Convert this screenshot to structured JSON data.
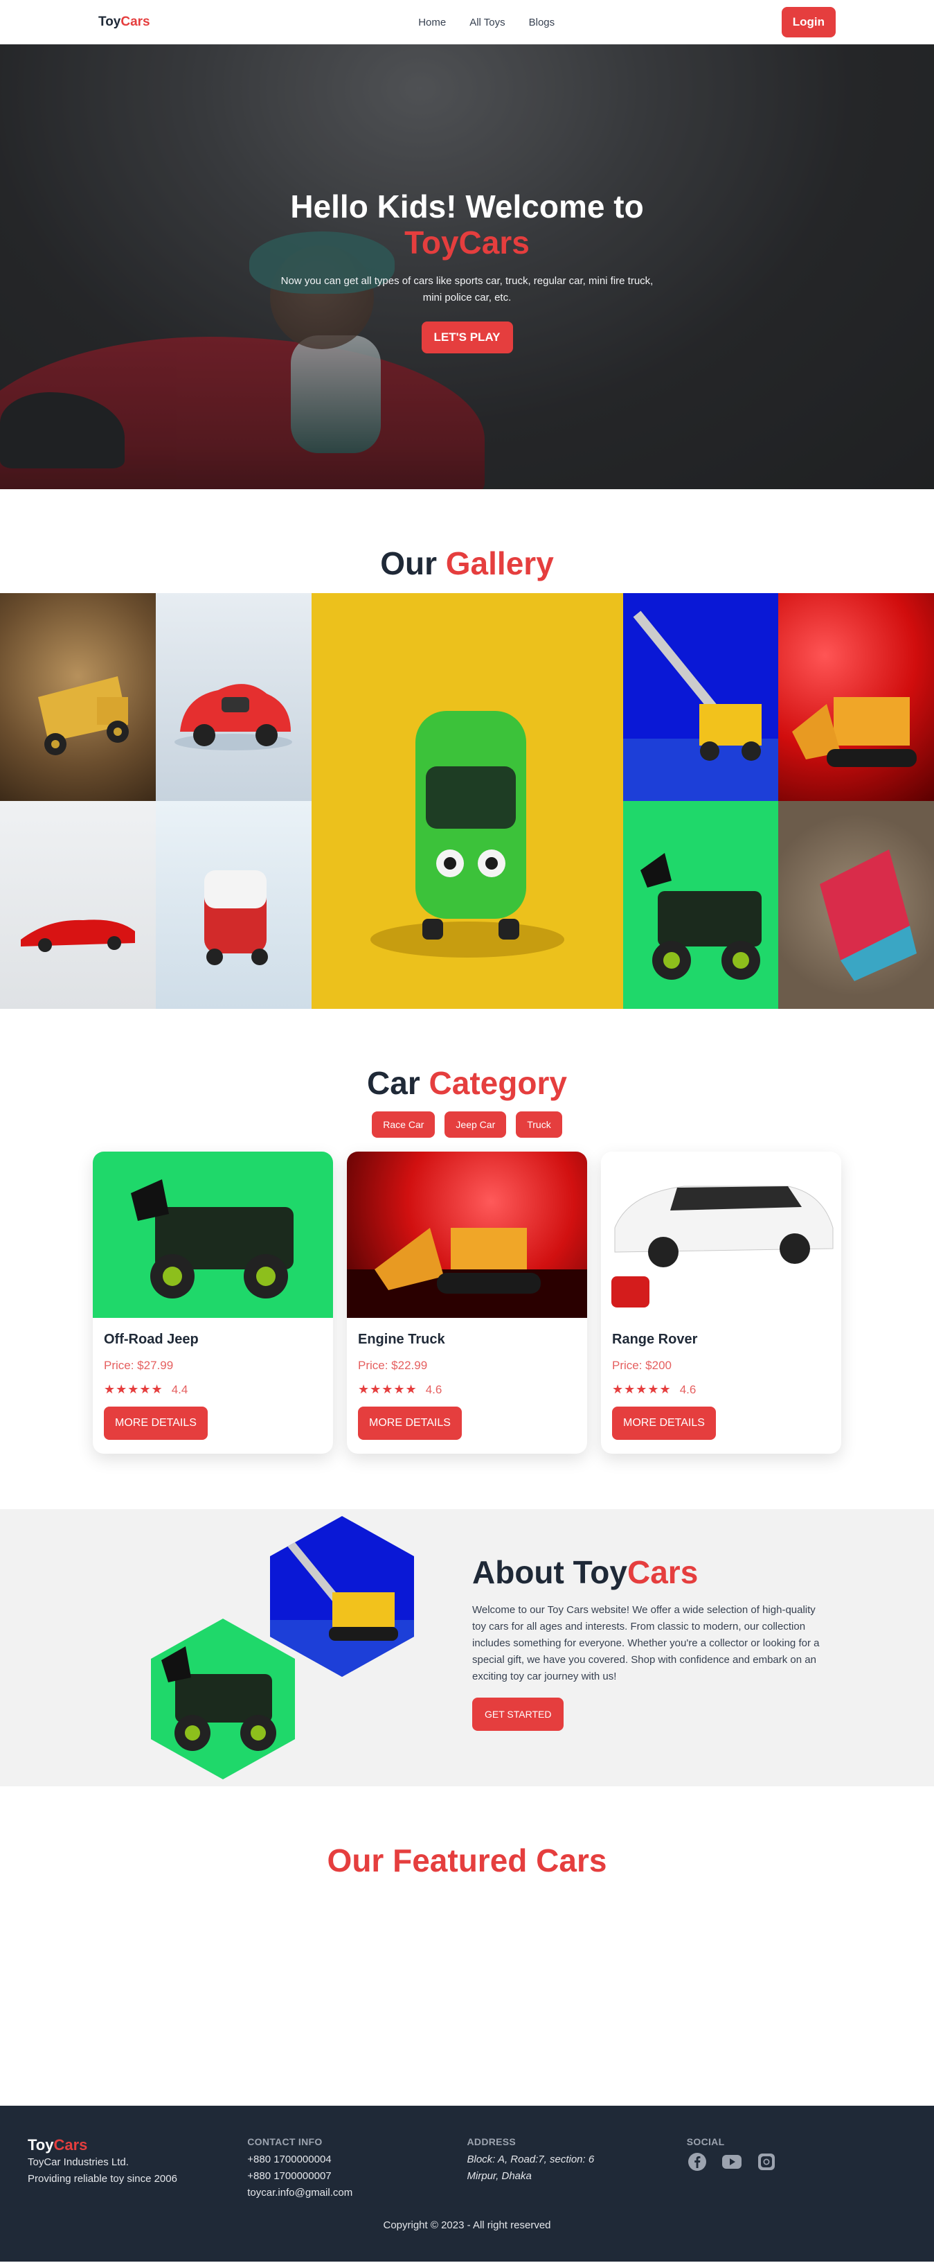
{
  "nav": {
    "brand_main": "Toy",
    "brand_accent": "Cars",
    "links": [
      "Home",
      "All Toys",
      "Blogs"
    ],
    "login": "Login"
  },
  "hero": {
    "title_line1": "Hello Kids! Welcome to",
    "title_accent": "ToyCars",
    "subtitle": "Now you can get all types of cars like sports car, truck, regular car, mini fire truck, mini police car, etc.",
    "cta": "LET'S PLAY"
  },
  "gallery": {
    "title_main": "Our",
    "title_accent": "Gallery"
  },
  "category": {
    "title_main": "Car",
    "title_accent": "Category",
    "tabs": [
      "Race Car",
      "Jeep Car",
      "Truck"
    ],
    "cards": [
      {
        "name": "Off-Road Jeep",
        "price": "Price: $27.99",
        "rating": "4.4",
        "stars": "★★★★★",
        "button": "MORE DETAILS"
      },
      {
        "name": "Engine Truck",
        "price": "Price: $22.99",
        "rating": "4.6",
        "stars": "★★★★★",
        "button": "MORE DETAILS"
      },
      {
        "name": "Range Rover",
        "price": "Price: $200",
        "rating": "4.6",
        "stars": "★★★★★",
        "button": "MORE DETAILS"
      }
    ]
  },
  "about": {
    "title_main": "About Toy",
    "title_accent": "Cars",
    "description": "Welcome to our Toy Cars website! We offer a wide selection of high-quality toy cars for all ages and interests. From classic to modern, our collection includes something for everyone. Whether you're a collector or looking for a special gift, we have you covered. Shop with confidence and embark on an exciting toy car journey with us!",
    "button": "GET STARTED"
  },
  "featured": {
    "title": "Our Featured Cars"
  },
  "footer": {
    "brand_main": "Toy",
    "brand_accent": "Cars",
    "company": "ToyCar Industries Ltd.",
    "tagline": "Providing reliable toy since 2006",
    "contact_head": "CONTACT INFO",
    "phone1": "+880 1700000004",
    "phone2": "+880 1700000007",
    "email": "toycar.info@gmail.com",
    "address_head": "ADDRESS",
    "address1": "Block: A, Road:7, section: 6",
    "address2": "Mirpur, Dhaka",
    "social_head": "SOCIAL",
    "social_icons": [
      "facebook-icon",
      "youtube-icon",
      "instagram-icon"
    ],
    "copyright": "Copyright © 2023 - All right reserved"
  },
  "colors": {
    "accent": "#e53e3e",
    "dark": "#1f2937",
    "about_bg": "#f2f2f2"
  }
}
